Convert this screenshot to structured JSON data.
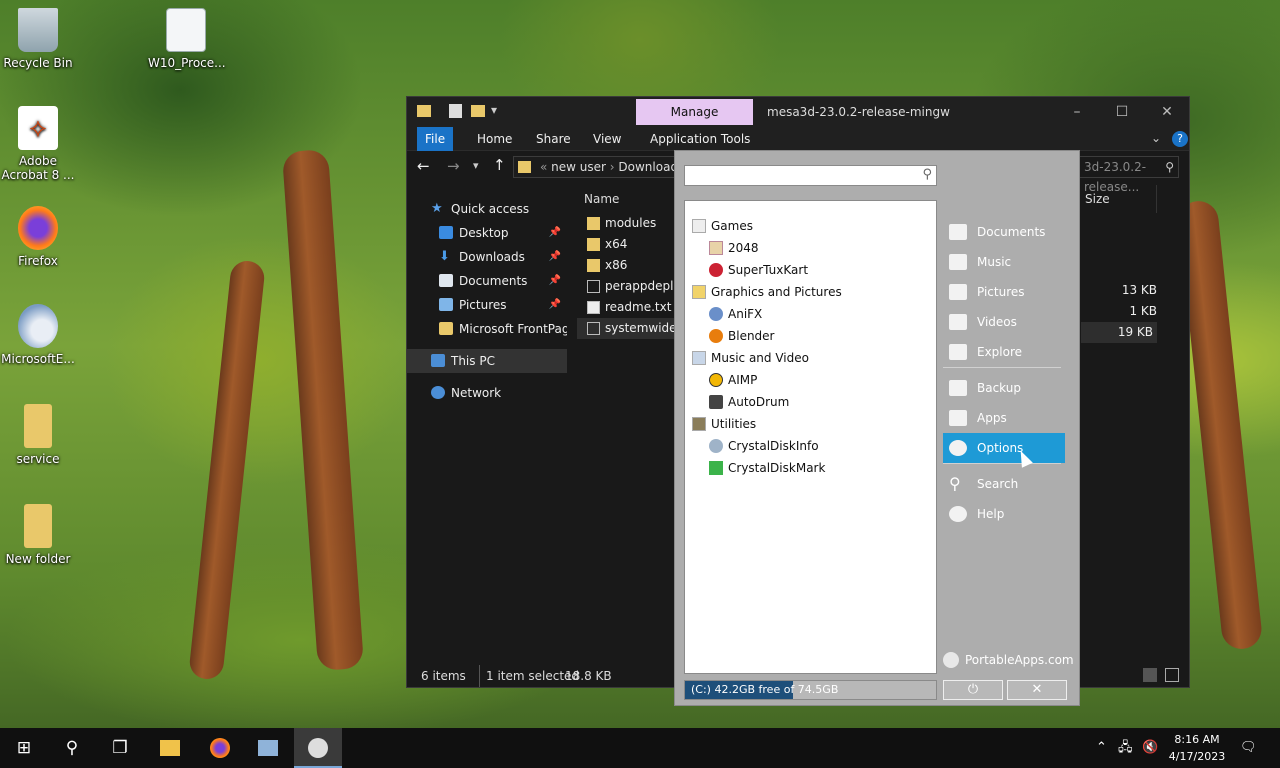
{
  "desktop": {
    "icons": [
      {
        "label": "Recycle Bin",
        "icon": "recycle-bin-icon"
      },
      {
        "label": "W10_Proce...",
        "icon": "file-icon"
      },
      {
        "label": "Adobe Acrobat 8 ...",
        "icon": "acrobat-icon"
      },
      {
        "label": "Firefox",
        "icon": "firefox-icon"
      },
      {
        "label": "MicrosoftE...",
        "icon": "installer-icon"
      },
      {
        "label": "service",
        "icon": "folder-icon"
      },
      {
        "label": "New folder",
        "icon": "folder-icon"
      }
    ]
  },
  "explorer": {
    "title": "mesa3d-23.0.2-release-mingw",
    "manage_tab": "Manage",
    "ribbon_tabs": [
      "File",
      "Home",
      "Share",
      "View",
      "Application Tools"
    ],
    "address": {
      "seg1": "new user",
      "seg2": "Downloads"
    },
    "search_placeholder": "3d-23.0.2-release...",
    "nav": {
      "quick_access": "Quick access",
      "items": [
        "Desktop",
        "Downloads",
        "Documents",
        "Pictures",
        "Microsoft FrontPage"
      ],
      "this_pc": "This PC",
      "network": "Network"
    },
    "columns": {
      "name": "Name",
      "size": "Size"
    },
    "files": [
      {
        "name": "modules",
        "size": ""
      },
      {
        "name": "x64",
        "size": ""
      },
      {
        "name": "x86",
        "size": ""
      },
      {
        "name": "perappdeploy",
        "size": "13 KB"
      },
      {
        "name": "readme.txt",
        "size": "1 KB"
      },
      {
        "name": "systemwidedeploy",
        "size": "19 KB"
      }
    ],
    "status": {
      "items": "6 items",
      "selected": "1 item selected",
      "size": "18.8 KB"
    }
  },
  "portableapps": {
    "search_value": "",
    "categories": [
      {
        "name": "Games",
        "apps": [
          "2048",
          "SuperTuxKart"
        ]
      },
      {
        "name": "Graphics and Pictures",
        "apps": [
          "AniFX",
          "Blender"
        ]
      },
      {
        "name": "Music and Video",
        "apps": [
          "AIMP",
          "AutoDrum"
        ]
      },
      {
        "name": "Utilities",
        "apps": [
          "CrystalDiskInfo",
          "CrystalDiskMark"
        ]
      }
    ],
    "links_top": [
      "Documents",
      "Music",
      "Pictures",
      "Videos",
      "Explore"
    ],
    "links_bottom": [
      "Backup",
      "Apps",
      "Options",
      "Search",
      "Help"
    ],
    "brand": "PortableApps.com",
    "disk": {
      "text": "(C:) 42.2GB free of 74.5GB",
      "used_fraction": 0.43
    },
    "power_glyph": "⏻",
    "close_glyph": "✕"
  },
  "taskbar": {
    "time": "8:16 AM",
    "date": "4/17/2023"
  },
  "colors": {
    "accent": "#1e9ad6",
    "manage_tab": "#e6c7f2",
    "file_tab": "#1a73c7"
  }
}
